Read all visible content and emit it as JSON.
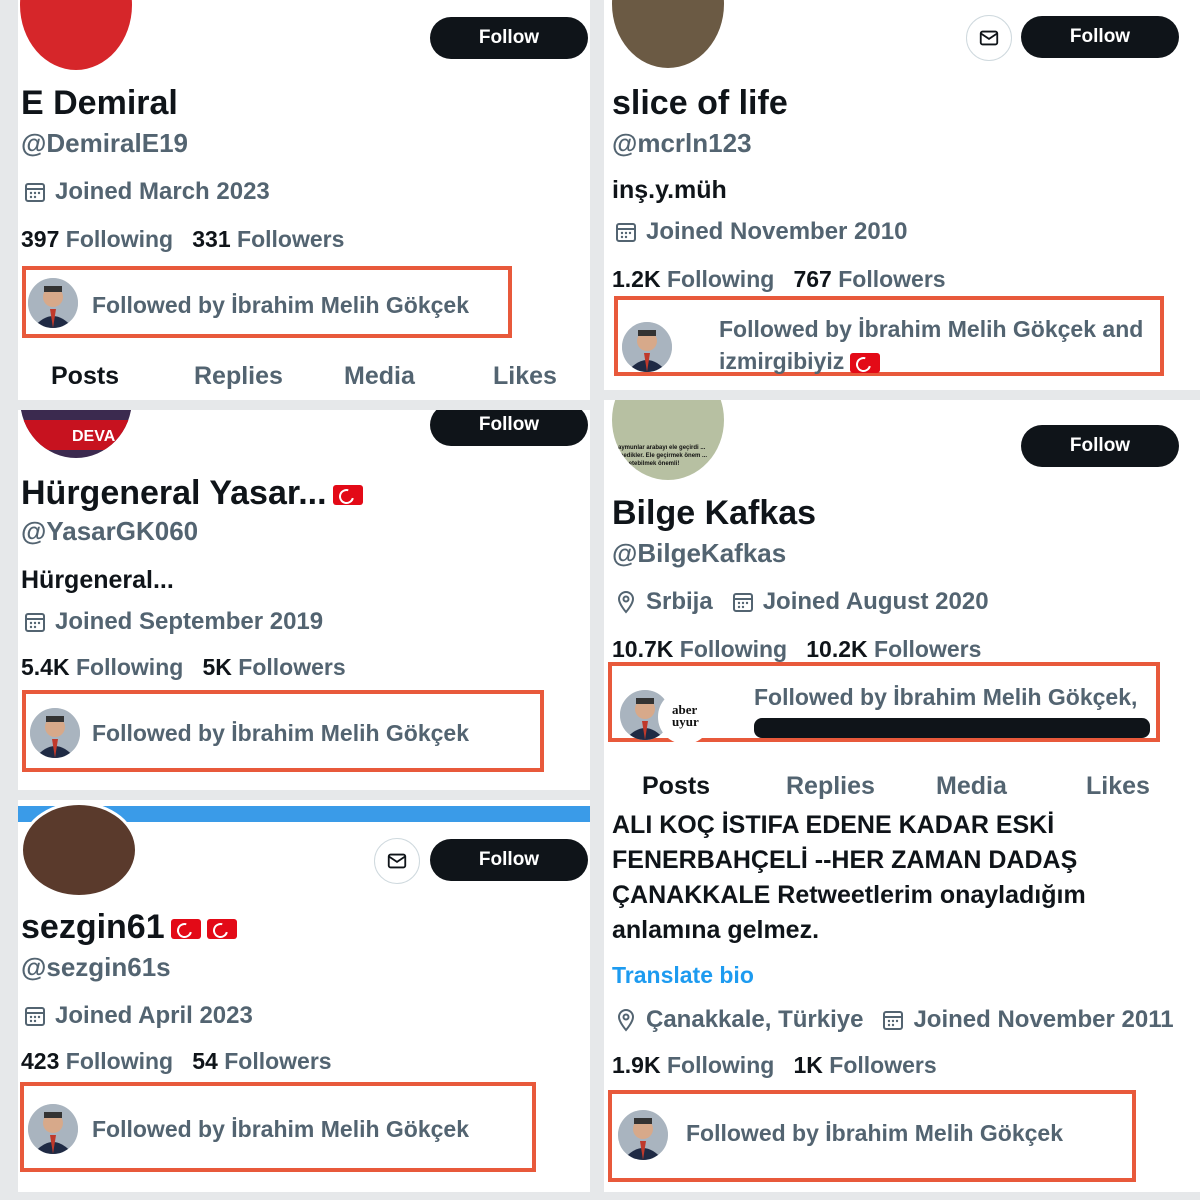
{
  "follow_label": "Follow",
  "p1": {
    "name": "E Demiral",
    "handle": "@DemiralE19",
    "joined": "Joined March 2023",
    "following_count": "397",
    "following_label": "Following",
    "followers_count": "331",
    "followers_label": "Followers",
    "followed_by": "Followed by İbrahim Melih Gökçek",
    "tabs": [
      "Posts",
      "Replies",
      "Media",
      "Likes"
    ]
  },
  "p2": {
    "name": "slice of life",
    "handle": "@mcrln123",
    "bio": "inş.y.müh",
    "joined": "Joined November 2010",
    "following_count": "1.2K",
    "following_label": "Following",
    "followers_count": "767",
    "followers_label": "Followers",
    "followed_by_1": "Followed by İbrahim Melih Gökçek and",
    "followed_by_2": "izmirgibiyiz"
  },
  "p3": {
    "name": "Hürgeneral Yasar...",
    "handle": "@YasarGK060",
    "bio": "Hürgeneral...",
    "joined": "Joined September 2019",
    "following_count": "5.4K",
    "following_label": "Following",
    "followers_count": "5K",
    "followers_label": "Followers",
    "followed_by": "Followed by İbrahim Melih Gökçek",
    "avatar_text": "DEVA"
  },
  "p4": {
    "name": "Bilge Kafkas",
    "handle": "@BilgeKafkas",
    "location": "Srbija",
    "joined": "Joined August 2020",
    "following_count": "10.7K",
    "following_label": "Following",
    "followers_count": "10.2K",
    "followers_label": "Followers",
    "followed_by": "Followed by İbrahim Melih Gökçek,",
    "avatar2_text": "aber uyur",
    "avatar_caption": "aymunlar arabayı ele geçirdi ... medikler. Ele geçirmek önem ... yönetebilmek önemli!",
    "tabs": [
      "Posts",
      "Replies",
      "Media",
      "Likes"
    ]
  },
  "p5": {
    "name": "sezgin61",
    "handle": "@sezgin61s",
    "joined": "Joined April 2023",
    "following_count": "423",
    "following_label": "Following",
    "followers_count": "54",
    "followers_label": "Followers",
    "followed_by": "Followed by İbrahim Melih Gökçek"
  },
  "p6": {
    "bio_lines": [
      "ALI KOÇ İSTIFA EDENE KADAR ESKİ",
      "FENERBAHÇELİ --HER ZAMAN DADAŞ",
      "ÇANAKKALE Retweetlerim onayladığım",
      "anlamına gelmez."
    ],
    "translate": "Translate bio",
    "location": "Çanakkale, Türkiye",
    "joined": "Joined November 2011",
    "following_count": "1.9K",
    "following_label": "Following",
    "followers_count": "1K",
    "followers_label": "Followers",
    "followed_by": "Followed by İbrahim Melih Gökçek"
  },
  "colors": {
    "highlight_border": "#e8593b",
    "follow_bg": "#0f1419",
    "muted": "#536471",
    "link": "#1d9bf0",
    "flag_red": "#e30a17"
  },
  "icons": [
    "calendar-icon",
    "location-icon",
    "mail-icon",
    "turkish-flag-icon"
  ]
}
